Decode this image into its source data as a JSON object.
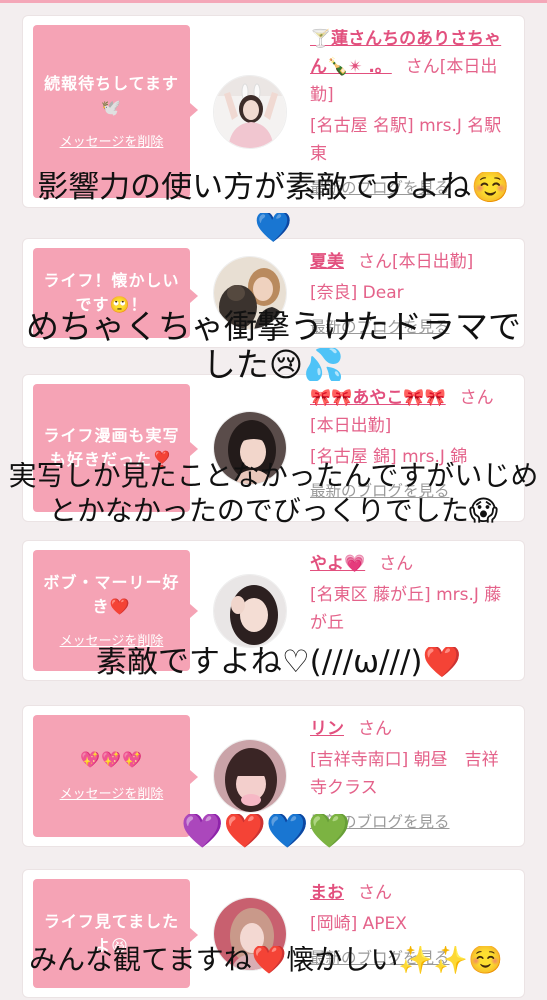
{
  "colors": {
    "page_background": "#f3eeef",
    "top_bar": "#f4a7b8",
    "card_background": "#ffffff",
    "card_border": "#ebe3e4",
    "message_box": "#f5a3b5",
    "name": "#e2507e",
    "detail": "#e4628a",
    "blog_link": "#9a9a9a",
    "caption": "#111111"
  },
  "cards": [
    {
      "message": "続報待ちしてます🕊️",
      "delete_label": "メッセージを削除",
      "name": "🍸蓮さんちのありさちゃん🍾✴︎ .。",
      "suffix": "さん[本日出勤]",
      "location": "[名古屋 名駅] mrs.J 名駅東",
      "blog_link": "最新のブログを見る"
    },
    {
      "message": "ライフ！懐かしいです🙄！",
      "name": "夏美",
      "suffix": "さん[本日出勤]",
      "location": "[奈良] Dear",
      "blog_link": "最新のブログを見る"
    },
    {
      "message": "ライフ漫画も実写も好きだった❣️",
      "name": "🎀🎀あやこ🎀🎀",
      "suffix": "さん[本日出勤]",
      "location": "[名古屋 錦] mrs.J 錦",
      "blog_link": "最新のブログを見る"
    },
    {
      "message": "ボブ・マーリー好き❤️",
      "delete_label": "メッセージを削除",
      "name": "やよ💗",
      "suffix": "さん",
      "location": "[名東区 藤が丘] mrs.J 藤が丘"
    },
    {
      "message": "💖💖💖",
      "delete_label": "メッセージを削除",
      "name": "リン",
      "suffix": "さん",
      "location": "[吉祥寺南口] 朝昼　吉祥寺クラス",
      "blog_link": "最新のブログを見る"
    },
    {
      "message": "ライフ見てましたよ😆",
      "name": "まお",
      "suffix": "さん",
      "location": "[岡崎] APEX",
      "blog_link": "最新のブログを見る"
    }
  ],
  "captions": [
    {
      "lines": [
        "影響力の使い方が素敵ですよね☺️",
        "💙"
      ]
    },
    {
      "lines": [
        "めちゃくちゃ衝撃うけたドラマで",
        "した😢💦"
      ]
    },
    {
      "lines": [
        "実写しか見たことなかったんですがいじめ",
        "とかなかったのでびっくりでした😱"
      ]
    },
    {
      "lines": [
        "素敵ですよね♡(///ω///)❤️"
      ]
    },
    {
      "lines": [
        "💜❤️💙💚"
      ]
    },
    {
      "lines": [
        "みんな観てますね❤️懐かしい✨✨☺️"
      ]
    }
  ]
}
